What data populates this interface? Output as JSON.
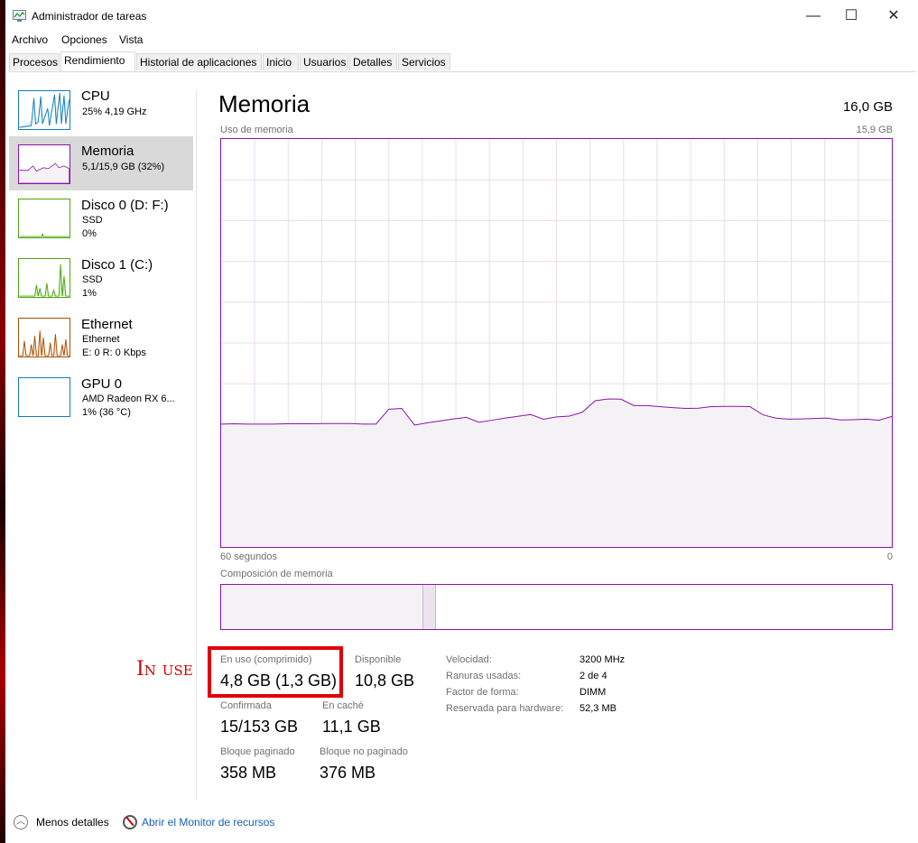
{
  "window": {
    "title": "Administrador de tareas",
    "minimize": "—",
    "maximize": "☐",
    "close": "✕"
  },
  "menu": [
    "Archivo",
    "Opciones",
    "Vista"
  ],
  "tabs": [
    "Procesos",
    "Rendimiento",
    "Historial de aplicaciones",
    "Inicio",
    "Usuarios",
    "Detalles",
    "Servicios"
  ],
  "active_tab": "Rendimiento",
  "sidebar": [
    {
      "name": "CPU",
      "line1": "25% 4,19 GHz",
      "line2": "",
      "line3": "",
      "color": "#117dbb"
    },
    {
      "name": "Memoria",
      "line1": "5,1/15,9 GB (32%)",
      "line2": "",
      "line3": "",
      "color": "#8b12ae"
    },
    {
      "name": "Disco 0 (D: F:)",
      "line1": "SSD",
      "line2": "0%",
      "line3": "",
      "color": "#4da60c"
    },
    {
      "name": "Disco 1 (C:)",
      "line1": "SSD",
      "line2": "1%",
      "line3": "",
      "color": "#4da60c"
    },
    {
      "name": "Ethernet",
      "line1": "Ethernet",
      "line2": "E: 0 R: 0 Kbps",
      "line3": "",
      "color": "#a74f01"
    },
    {
      "name": "GPU 0",
      "line1": "AMD Radeon RX 6...",
      "line2": "1% (36 °C)",
      "line3": "",
      "color": "#117dbb"
    }
  ],
  "main": {
    "title": "Memoria",
    "total": "16,0 GB",
    "graph_label": "Uso de memoria",
    "graph_max": "15,9 GB",
    "time_left": "60 segundos",
    "time_right": "0",
    "composition_label": "Composición de memoria"
  },
  "memory_usage_gb": [
    4.79,
    4.8,
    4.79,
    4.79,
    4.79,
    4.8,
    4.8,
    4.8,
    4.81,
    4.81,
    4.81,
    4.79,
    4.79,
    5.37,
    5.4,
    4.75,
    4.84,
    4.91,
    4.99,
    5.05,
    4.86,
    4.94,
    5.02,
    5.09,
    5.16,
    4.98,
    5.07,
    5.1,
    5.25,
    5.7,
    5.77,
    5.76,
    5.51,
    5.51,
    5.47,
    5.43,
    5.4,
    5.41,
    5.47,
    5.48,
    5.48,
    5.47,
    5.15,
    5.02,
    4.98,
    4.99,
    5.01,
    5.02,
    4.95,
    4.96,
    4.98,
    4.94,
    5.09
  ],
  "memory_scale_max_gb": 15.9,
  "composition": {
    "in_use_fraction": 0.3,
    "modified_fraction": 0.018
  },
  "stats": {
    "in_use_label": "En uso (comprimido)",
    "in_use_value": "4,8 GB (1,3 GB)",
    "available_label": "Disponible",
    "available_value": "10,8 GB",
    "committed_label": "Confirmada",
    "committed_value": "15/153 GB",
    "cached_label": "En caché",
    "cached_value": "11,1 GB",
    "paged_label": "Bloque paginado",
    "paged_value": "358 MB",
    "nonpaged_label": "Bloque no paginado",
    "nonpaged_value": "376 MB"
  },
  "details": [
    {
      "label": "Velocidad:",
      "value": "3200 MHz"
    },
    {
      "label": "Ranuras usadas:",
      "value": "2 de 4"
    },
    {
      "label": "Factor de forma:",
      "value": "DIMM"
    },
    {
      "label": "Reservada para hardware:",
      "value": "52,3 MB"
    }
  ],
  "annotation": "In use",
  "footer": {
    "less_details": "Menos detalles",
    "resource_monitor": "Abrir el Monitor de recursos"
  },
  "colors": {
    "memory": "#8b12ae",
    "memory_fill": "#f4f2f4",
    "annotation": "#e0000a"
  }
}
